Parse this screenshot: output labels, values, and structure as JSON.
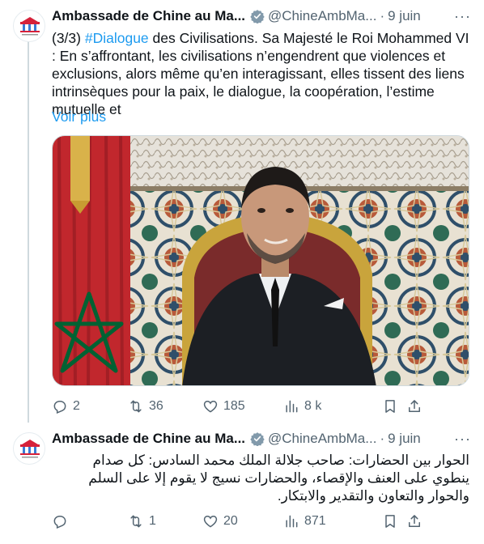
{
  "tweets": [
    {
      "author_name": "Ambassade de Chine au Ma...",
      "handle": "@ChineAmbMa...",
      "separator": "·",
      "time": "9 juin",
      "text_prefix": "(3/3) ",
      "hashtag": "#Dialogue",
      "text_suffix": " des Civilisations. Sa Majesté le Roi Mohammed VI : En s’affrontant, les civilisations n’engendrent que violences et exclusions, alors même qu’en interagissant, elles tissent des liens intrinsèques pour la paix, le dialogue, la coopération, l’estime mutuelle et",
      "show_more": "Voir plus",
      "counts": {
        "replies": "2",
        "retweets": "36",
        "likes": "185",
        "views": "8 k"
      }
    },
    {
      "author_name": "Ambassade de Chine au Ma...",
      "handle": "@ChineAmbMa...",
      "separator": "·",
      "time": "9 juin",
      "text": "الحوار بين الحضارات: صاحب جلالة الملك محمد السادس: كل صدام ينطوي على العنف والإقصاء، والحضارات نسيج لا يقوم إلا على السلم والحوار والتعاون والتقدير والابتكار.",
      "counts": {
        "replies": "",
        "retweets": "1",
        "likes": "20",
        "views": "871"
      }
    }
  ],
  "colors": {
    "accent": "#1d9bf0",
    "muted": "#536471",
    "verified": "#829aab",
    "flag_red": "#c1272d",
    "flag_green": "#006233"
  },
  "icons": [
    "reply-icon",
    "retweet-icon",
    "like-icon",
    "views-icon",
    "bookmark-icon",
    "share-icon",
    "verified-badge-icon",
    "more-icon"
  ]
}
